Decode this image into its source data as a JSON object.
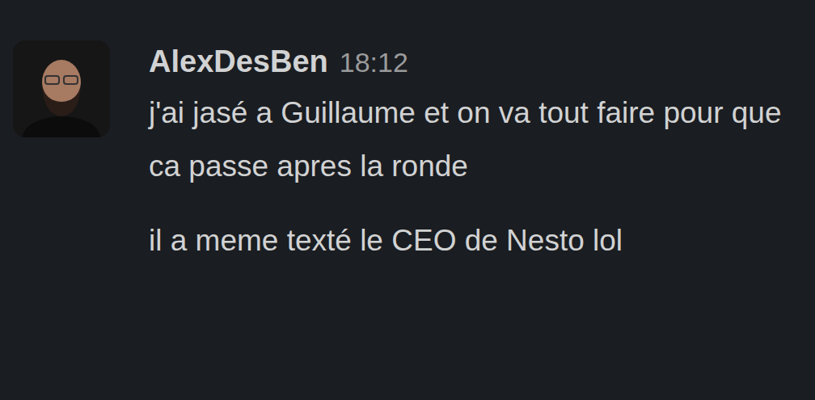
{
  "message": {
    "author": "AlexDesBen",
    "time": "18:12",
    "paragraphs": [
      "j'ai jasé a Guillaume et on va tout faire pour que ca passe apres la ronde",
      "il a meme texté le CEO de Nesto lol"
    ]
  }
}
